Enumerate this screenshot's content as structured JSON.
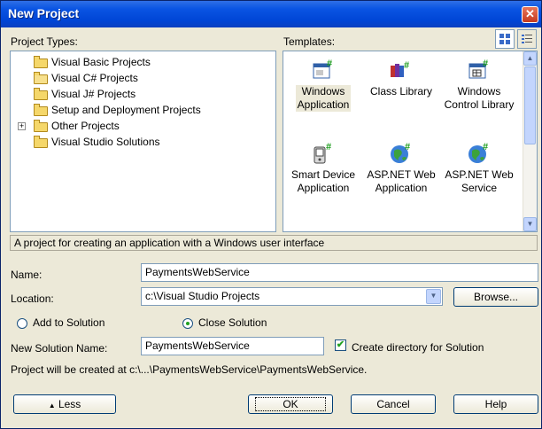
{
  "window": {
    "title": "New Project",
    "close_glyph": "✕"
  },
  "project_types": {
    "label": "Project Types:",
    "items": [
      {
        "label": "Visual Basic Projects",
        "icon": "folder-icon"
      },
      {
        "label": "Visual C# Projects",
        "icon": "folder-open-icon"
      },
      {
        "label": "Visual J# Projects",
        "icon": "folder-icon"
      },
      {
        "label": "Setup and Deployment Projects",
        "icon": "folder-icon"
      },
      {
        "label": "Other Projects",
        "icon": "folder-icon",
        "expander": "+"
      },
      {
        "label": "Visual Studio Solutions",
        "icon": "folder-icon"
      }
    ]
  },
  "templates": {
    "label": "Templates:",
    "items": [
      {
        "label_line1": "Windows",
        "label_line2": "Application",
        "icon": "windows-app-icon"
      },
      {
        "label_line1": "Class Library",
        "label_line2": "",
        "icon": "class-library-icon"
      },
      {
        "label_line1": "Windows",
        "label_line2": "Control Library",
        "icon": "control-library-icon"
      },
      {
        "label_line1": "Smart Device",
        "label_line2": "Application",
        "icon": "smart-device-icon"
      },
      {
        "label_line1": "ASP.NET Web",
        "label_line2": "Application",
        "icon": "globe-icon"
      },
      {
        "label_line1": "ASP.NET Web",
        "label_line2": "Service",
        "icon": "globe-icon"
      }
    ],
    "view_large_icons": "large-icons-view-icon",
    "view_small_icons": "small-icons-view-icon"
  },
  "description": "A project for creating an application with a Windows user interface",
  "name_field": {
    "label": "Name:",
    "value": "PaymentsWebService"
  },
  "location_field": {
    "label": "Location:",
    "value": "c:\\Visual Studio Projects"
  },
  "browse_button": "Browse...",
  "add_to_solution": "Add to Solution",
  "close_solution": "Close Solution",
  "solution_name": {
    "label": "New Solution Name:",
    "value": "PaymentsWebService"
  },
  "create_directory": "Create directory for Solution",
  "path_note": "Project will be created at c:\\...\\PaymentsWebService\\PaymentsWebService.",
  "buttons": {
    "less": "Less",
    "less_glyph": "▲",
    "ok": "OK",
    "cancel": "Cancel",
    "help": "Help"
  }
}
